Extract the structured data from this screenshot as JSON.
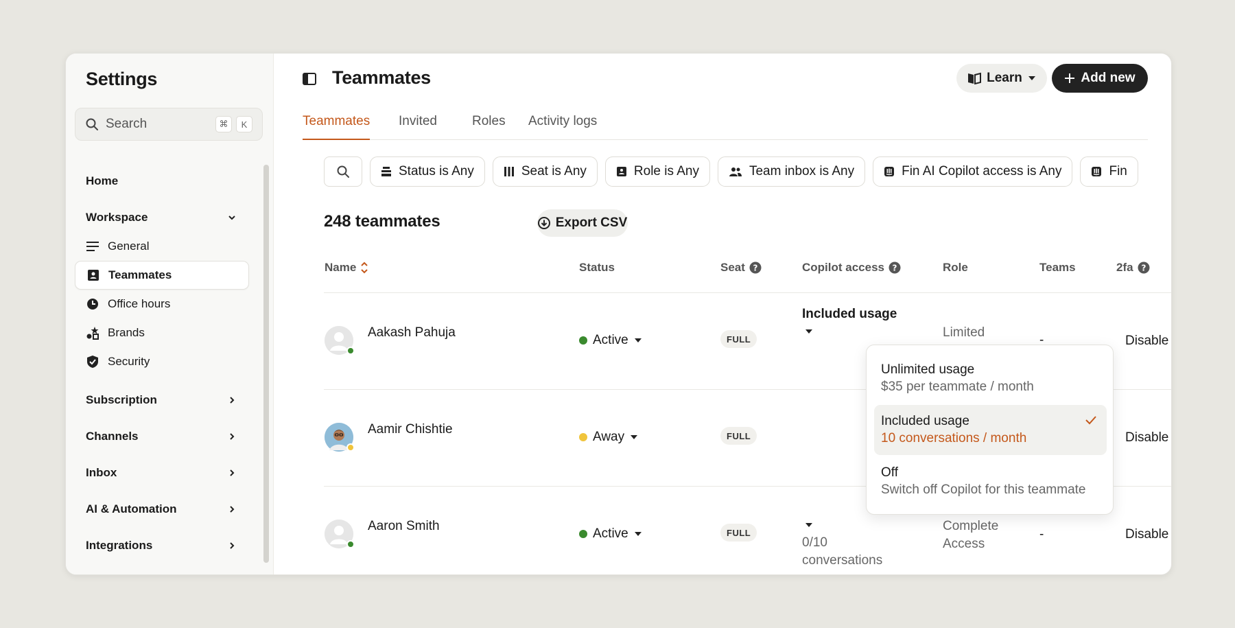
{
  "sidebar": {
    "title": "Settings",
    "search_placeholder": "Search",
    "shortcut_keys": [
      "⌘",
      "K"
    ],
    "home": "Home",
    "workspace": "Workspace",
    "workspace_items": [
      {
        "label": "General",
        "icon": "lines-icon"
      },
      {
        "label": "Teammates",
        "icon": "contact-card-icon",
        "active": true
      },
      {
        "label": "Office hours",
        "icon": "clock-icon"
      },
      {
        "label": "Brands",
        "icon": "shapes-icon"
      },
      {
        "label": "Security",
        "icon": "shield-check-icon"
      }
    ],
    "sections": [
      "Subscription",
      "Channels",
      "Inbox",
      "AI & Automation",
      "Integrations"
    ]
  },
  "header": {
    "title": "Teammates",
    "learn_label": "Learn",
    "add_label": "Add new"
  },
  "tabs": [
    "Teammates",
    "Invited",
    "Roles",
    "Activity logs"
  ],
  "filters": [
    "Status is Any",
    "Seat is Any",
    "Role is Any",
    "Team inbox is Any",
    "Fin AI Copilot access is Any",
    "Fin"
  ],
  "summary": {
    "count": "248 teammates",
    "export_label": "Export CSV"
  },
  "columns": [
    "Name",
    "Status",
    "Seat",
    "Copilot access",
    "Role",
    "Teams",
    "2fa"
  ],
  "rows": [
    {
      "name": "Aakash Pahuja",
      "status": "Active",
      "seat": "FULL",
      "copilot": "Included usage",
      "role": "Limited",
      "teams": "-",
      "twofa": "Disable"
    },
    {
      "name": "Aamir Chishtie",
      "status": "Away",
      "seat": "FULL",
      "copilot": "",
      "role": "",
      "teams": "",
      "twofa": "Disable"
    },
    {
      "name": "Aaron Smith",
      "status": "Active",
      "seat": "FULL",
      "copilot_usage": "0/10",
      "copilot_unit": "conversations",
      "role_line1": "Complete",
      "role_line2": "Access",
      "teams": "-",
      "twofa": "Disable"
    }
  ],
  "dropdown": {
    "options": [
      {
        "title": "Unlimited usage",
        "sub": "$35 per teammate / month"
      },
      {
        "title": "Included usage",
        "sub": "10 conversations / month",
        "selected": true
      },
      {
        "title": "Off",
        "sub": "Switch off Copilot for this teammate"
      }
    ]
  },
  "colors": {
    "accent": "#c4581b",
    "active": "#3a8a2e",
    "away": "#f0c43c"
  }
}
